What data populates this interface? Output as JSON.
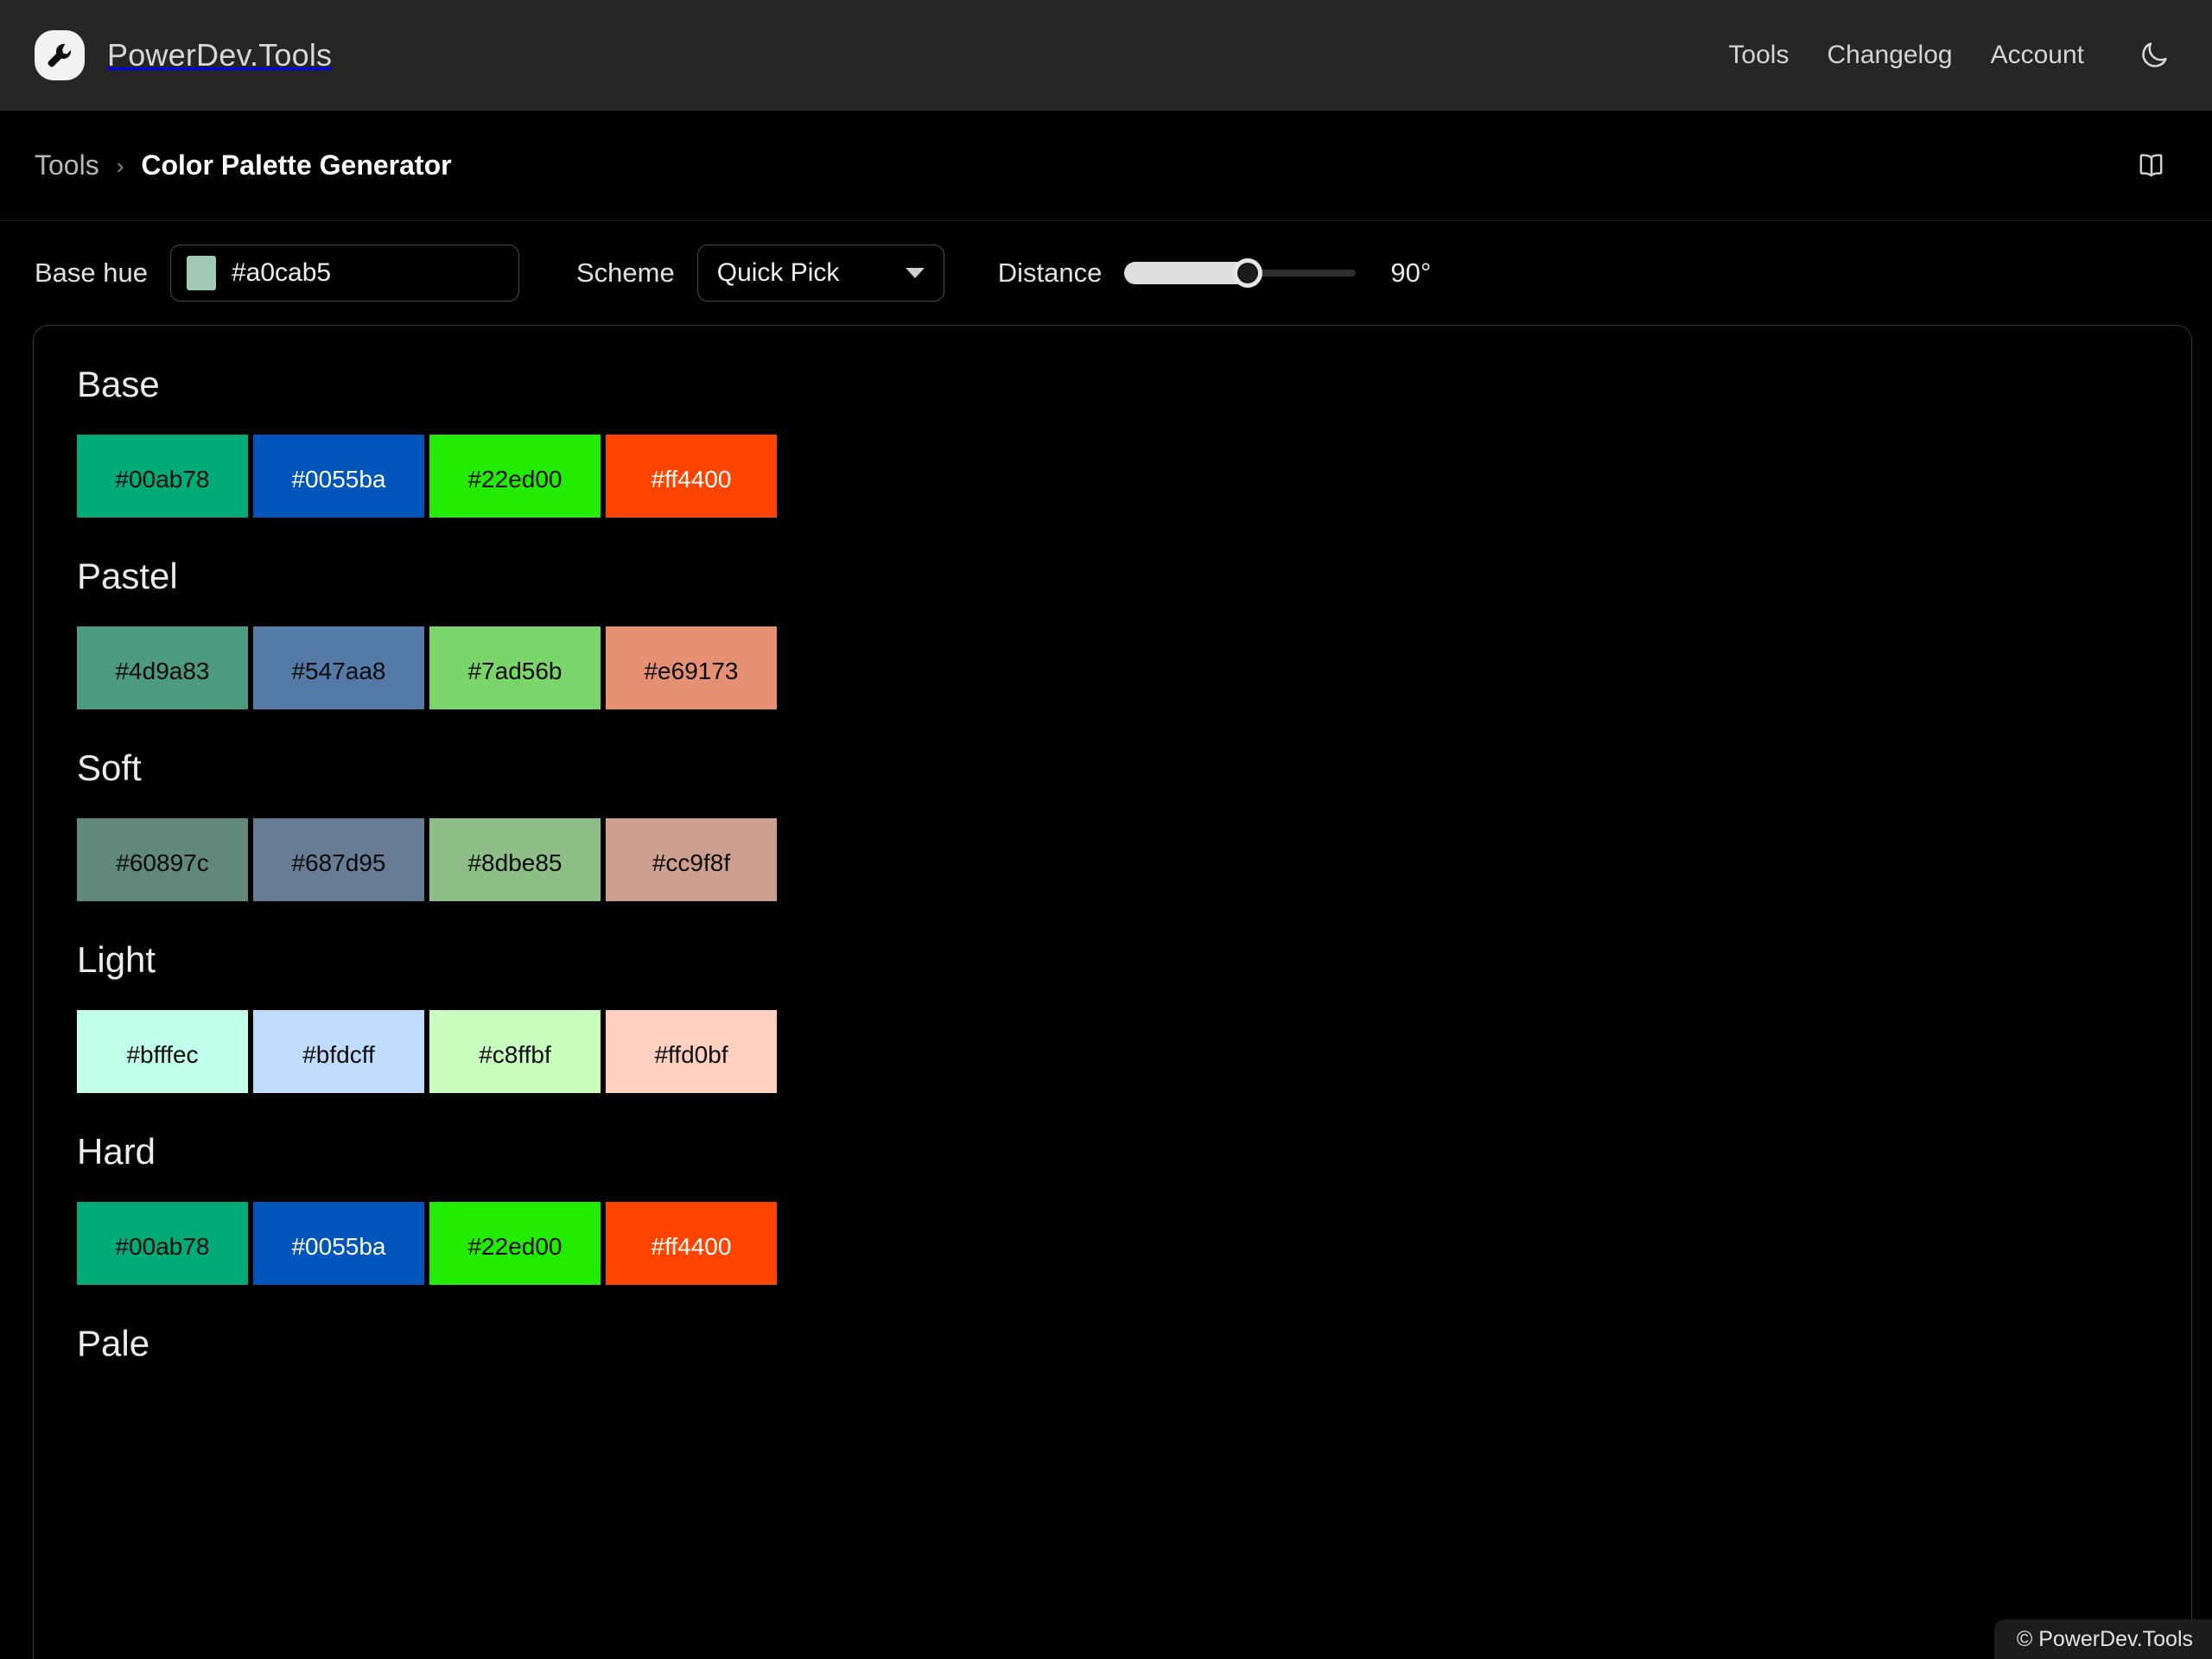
{
  "header": {
    "brand_name": "PowerDev.Tools",
    "logo_icon": "wrench-logo-icon",
    "nav": [
      {
        "label": "Tools",
        "icon": ""
      },
      {
        "label": "Changelog",
        "icon": ""
      },
      {
        "label": "Account",
        "icon": ""
      }
    ],
    "theme_toggle_icon": "moon-icon"
  },
  "breadcrumb": {
    "parent": "Tools",
    "separator": "›",
    "current": "Color Palette Generator",
    "docs_icon": "open-book-icon"
  },
  "controls": {
    "base_hue": {
      "label": "Base hue",
      "value": "#a0cab5",
      "placeholder": "#a0cab5",
      "swatch_color": "#a0cab5"
    },
    "scheme": {
      "label": "Scheme",
      "value": "Quick Pick",
      "caret_icon": "chevron-down-icon"
    },
    "distance": {
      "label": "Distance",
      "value": "90°",
      "percent": 55
    }
  },
  "palette": {
    "groups": [
      {
        "title": "Base",
        "swatches": [
          {
            "hex": "#00ab78",
            "text": "#00ab78",
            "text_color": "#0a0a0a"
          },
          {
            "hex": "#0055ba",
            "text": "#0055ba",
            "text_color": "#ffffff"
          },
          {
            "hex": "#22ed00",
            "text": "#22ed00",
            "text_color": "#0a0a0a"
          },
          {
            "hex": "#ff4400",
            "text": "#ff4400",
            "text_color": "#ffffff"
          }
        ]
      },
      {
        "title": "Pastel",
        "swatches": [
          {
            "hex": "#4d9a83",
            "text": "#4d9a83",
            "text_color": "#0a0a0a"
          },
          {
            "hex": "#547aa8",
            "text": "#547aa8",
            "text_color": "#0a0a0a"
          },
          {
            "hex": "#7ad56b",
            "text": "#7ad56b",
            "text_color": "#0a0a0a"
          },
          {
            "hex": "#e69173",
            "text": "#e69173",
            "text_color": "#0a0a0a"
          }
        ]
      },
      {
        "title": "Soft",
        "swatches": [
          {
            "hex": "#60897c",
            "text": "#60897c",
            "text_color": "#0a0a0a"
          },
          {
            "hex": "#687d95",
            "text": "#687d95",
            "text_color": "#0a0a0a"
          },
          {
            "hex": "#8dbe85",
            "text": "#8dbe85",
            "text_color": "#0a0a0a"
          },
          {
            "hex": "#cc9f8f",
            "text": "#cc9f8f",
            "text_color": "#0a0a0a"
          }
        ]
      },
      {
        "title": "Light",
        "swatches": [
          {
            "hex": "#bfffec",
            "text": "#bfffec",
            "text_color": "#0a0a0a"
          },
          {
            "hex": "#bfdcff",
            "text": "#bfdcff",
            "text_color": "#0a0a0a"
          },
          {
            "hex": "#c8ffbf",
            "text": "#c8ffbf",
            "text_color": "#0a0a0a"
          },
          {
            "hex": "#ffd0bf",
            "text": "#ffd0bf",
            "text_color": "#0a0a0a"
          }
        ]
      },
      {
        "title": "Hard",
        "swatches": [
          {
            "hex": "#00ab78",
            "text": "#00ab78",
            "text_color": "#0a0a0a"
          },
          {
            "hex": "#0055ba",
            "text": "#0055ba",
            "text_color": "#ffffff"
          },
          {
            "hex": "#22ed00",
            "text": "#22ed00",
            "text_color": "#0a0a0a"
          },
          {
            "hex": "#ff4400",
            "text": "#ff4400",
            "text_color": "#ffffff"
          }
        ]
      },
      {
        "title": "Pale",
        "swatches": []
      }
    ]
  },
  "footer": {
    "copyright": "© PowerDev.Tools"
  }
}
